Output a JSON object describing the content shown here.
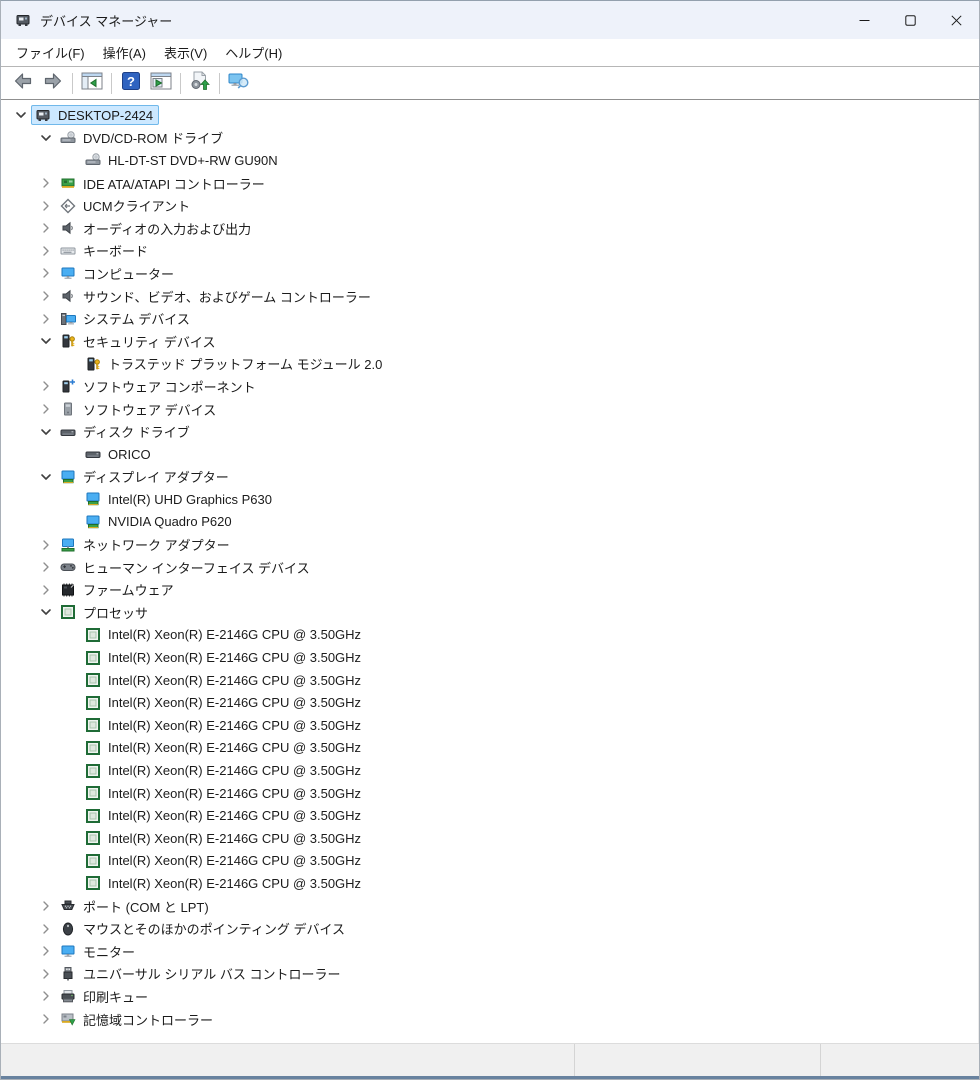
{
  "window": {
    "title": "デバイス マネージャー",
    "controls": [
      {
        "name": "minimize"
      },
      {
        "name": "maximize"
      },
      {
        "name": "close"
      }
    ]
  },
  "menu": {
    "items": [
      {
        "label": "ファイル(F)"
      },
      {
        "label": "操作(A)"
      },
      {
        "label": "表示(V)"
      },
      {
        "label": "ヘルプ(H)"
      }
    ]
  },
  "toolbar": {
    "buttons": [
      {
        "icon": "back-icon"
      },
      {
        "icon": "forward-icon"
      },
      {
        "icon": "show-console-tree-icon"
      },
      {
        "icon": "help-icon"
      },
      {
        "icon": "properties-icon"
      },
      {
        "icon": "scan-hardware-changes-icon"
      },
      {
        "icon": "devices-view-icon"
      }
    ]
  },
  "colors": {
    "titlebar_bg": "#eef2fa",
    "selection_bg": "#cce8ff",
    "selection_border": "#70b8ea",
    "cpu_icon_green": "#1f6b36",
    "adapter_card_green": "#3aa047",
    "key_gold": "#eab51c",
    "monitor_blue": "#4aaef2"
  },
  "tree": {
    "items": [
      {
        "label": "DESKTOP-2424",
        "level": 0,
        "state": "expanded",
        "icon": "computer-device",
        "selected": true
      },
      {
        "label": "DVD/CD-ROM ドライブ",
        "level": 1,
        "state": "expanded",
        "icon": "cd-drive"
      },
      {
        "label": "HL-DT-ST DVD+-RW GU90N",
        "level": 2,
        "state": "leaf",
        "icon": "cd-drive"
      },
      {
        "label": "IDE ATA/ATAPI コントローラー",
        "level": 1,
        "state": "collapsed",
        "icon": "ide-controller"
      },
      {
        "label": "UCMクライアント",
        "level": 1,
        "state": "collapsed",
        "icon": "ucm-client"
      },
      {
        "label": "オーディオの入力および出力",
        "level": 1,
        "state": "collapsed",
        "icon": "audio"
      },
      {
        "label": "キーボード",
        "level": 1,
        "state": "collapsed",
        "icon": "keyboard"
      },
      {
        "label": "コンピューター",
        "level": 1,
        "state": "collapsed",
        "icon": "monitor"
      },
      {
        "label": "サウンド、ビデオ、およびゲーム コントローラー",
        "level": 1,
        "state": "collapsed",
        "icon": "audio"
      },
      {
        "label": "システム デバイス",
        "level": 1,
        "state": "collapsed",
        "icon": "system-device"
      },
      {
        "label": "セキュリティ デバイス",
        "level": 1,
        "state": "expanded",
        "icon": "security-device"
      },
      {
        "label": "トラステッド プラットフォーム モジュール 2.0",
        "level": 2,
        "state": "leaf",
        "icon": "security-device"
      },
      {
        "label": "ソフトウェア コンポーネント",
        "level": 1,
        "state": "collapsed",
        "icon": "software-component"
      },
      {
        "label": "ソフトウェア デバイス",
        "level": 1,
        "state": "collapsed",
        "icon": "software-device"
      },
      {
        "label": "ディスク ドライブ",
        "level": 1,
        "state": "expanded",
        "icon": "disk-drive"
      },
      {
        "label": "ORICO",
        "level": 2,
        "state": "leaf",
        "icon": "disk-drive"
      },
      {
        "label": "ディスプレイ アダプター",
        "level": 1,
        "state": "expanded",
        "icon": "display-adapter"
      },
      {
        "label": "Intel(R) UHD Graphics P630",
        "level": 2,
        "state": "leaf",
        "icon": "display-adapter"
      },
      {
        "label": "NVIDIA Quadro P620",
        "level": 2,
        "state": "leaf",
        "icon": "display-adapter"
      },
      {
        "label": "ネットワーク アダプター",
        "level": 1,
        "state": "collapsed",
        "icon": "network-adapter"
      },
      {
        "label": "ヒューマン インターフェイス デバイス",
        "level": 1,
        "state": "collapsed",
        "icon": "hid"
      },
      {
        "label": "ファームウェア",
        "level": 1,
        "state": "collapsed",
        "icon": "firmware"
      },
      {
        "label": "プロセッサ",
        "level": 1,
        "state": "expanded",
        "icon": "processor"
      },
      {
        "label": "Intel(R) Xeon(R) E-2146G CPU @ 3.50GHz",
        "level": 2,
        "state": "leaf",
        "icon": "processor"
      },
      {
        "label": "Intel(R) Xeon(R) E-2146G CPU @ 3.50GHz",
        "level": 2,
        "state": "leaf",
        "icon": "processor"
      },
      {
        "label": "Intel(R) Xeon(R) E-2146G CPU @ 3.50GHz",
        "level": 2,
        "state": "leaf",
        "icon": "processor"
      },
      {
        "label": "Intel(R) Xeon(R) E-2146G CPU @ 3.50GHz",
        "level": 2,
        "state": "leaf",
        "icon": "processor"
      },
      {
        "label": "Intel(R) Xeon(R) E-2146G CPU @ 3.50GHz",
        "level": 2,
        "state": "leaf",
        "icon": "processor"
      },
      {
        "label": "Intel(R) Xeon(R) E-2146G CPU @ 3.50GHz",
        "level": 2,
        "state": "leaf",
        "icon": "processor"
      },
      {
        "label": "Intel(R) Xeon(R) E-2146G CPU @ 3.50GHz",
        "level": 2,
        "state": "leaf",
        "icon": "processor"
      },
      {
        "label": "Intel(R) Xeon(R) E-2146G CPU @ 3.50GHz",
        "level": 2,
        "state": "leaf",
        "icon": "processor"
      },
      {
        "label": "Intel(R) Xeon(R) E-2146G CPU @ 3.50GHz",
        "level": 2,
        "state": "leaf",
        "icon": "processor"
      },
      {
        "label": "Intel(R) Xeon(R) E-2146G CPU @ 3.50GHz",
        "level": 2,
        "state": "leaf",
        "icon": "processor"
      },
      {
        "label": "Intel(R) Xeon(R) E-2146G CPU @ 3.50GHz",
        "level": 2,
        "state": "leaf",
        "icon": "processor"
      },
      {
        "label": "Intel(R) Xeon(R) E-2146G CPU @ 3.50GHz",
        "level": 2,
        "state": "leaf",
        "icon": "processor"
      },
      {
        "label": "ポート (COM と LPT)",
        "level": 1,
        "state": "collapsed",
        "icon": "port"
      },
      {
        "label": "マウスとそのほかのポインティング デバイス",
        "level": 1,
        "state": "collapsed",
        "icon": "mouse"
      },
      {
        "label": "モニター",
        "level": 1,
        "state": "collapsed",
        "icon": "monitor"
      },
      {
        "label": "ユニバーサル シリアル バス コントローラー",
        "level": 1,
        "state": "collapsed",
        "icon": "usb"
      },
      {
        "label": "印刷キュー",
        "level": 1,
        "state": "collapsed",
        "icon": "printer"
      },
      {
        "label": "記憶域コントローラー",
        "level": 1,
        "state": "collapsed",
        "icon": "storage-controller"
      }
    ]
  },
  "statusbar": {
    "sections": 3
  }
}
